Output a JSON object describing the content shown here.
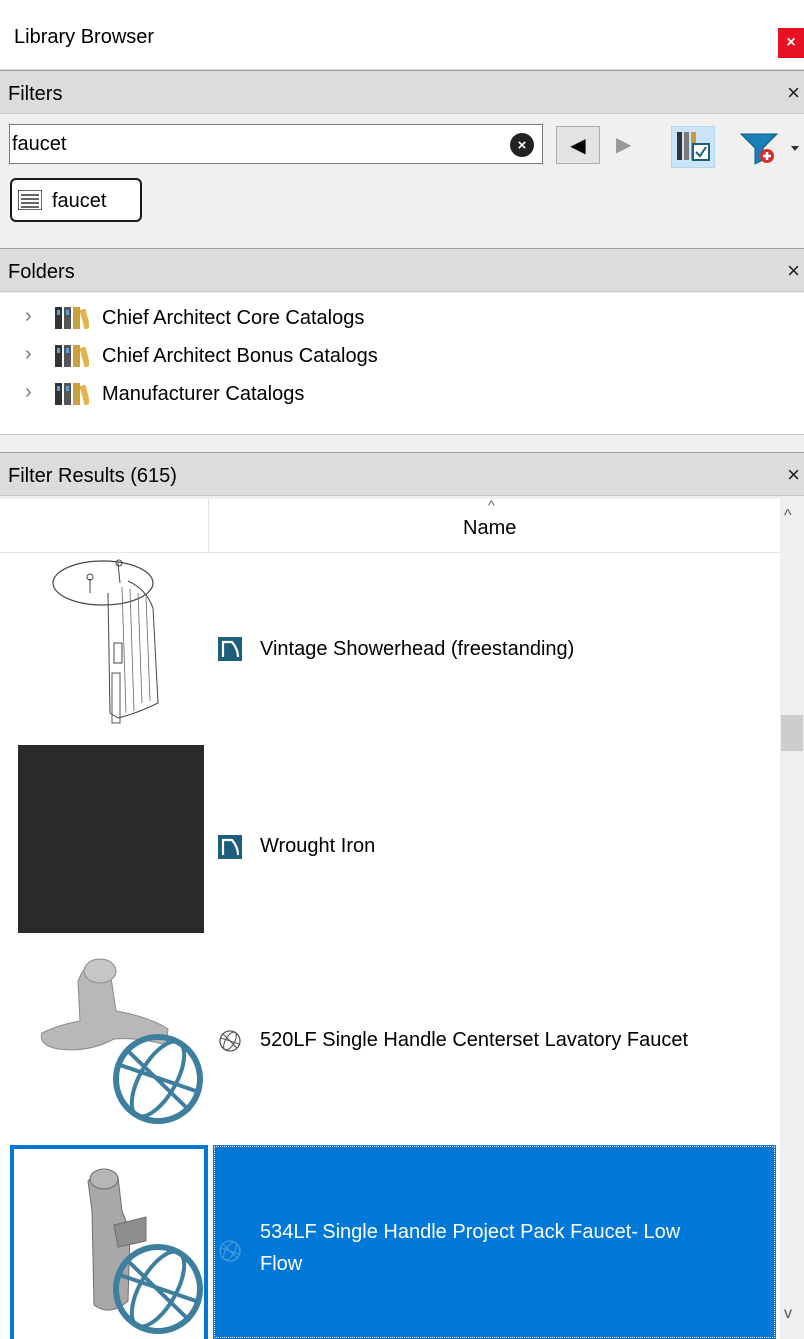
{
  "window": {
    "title": "Library Browser",
    "close_glyph": "×"
  },
  "filters": {
    "header": "Filters",
    "close_glyph": "×",
    "search_value": "faucet",
    "clear_glyph": "×",
    "nav_back_glyph": "◀",
    "nav_forward_glyph": "▶",
    "active_filter": "faucet"
  },
  "folders": {
    "header": "Folders",
    "close_glyph": "×",
    "items": [
      {
        "label": "Chief Architect Core Catalogs",
        "chevron": "›"
      },
      {
        "label": "Chief Architect Bonus Catalogs",
        "chevron": "›"
      },
      {
        "label": "Manufacturer Catalogs",
        "chevron": "›"
      }
    ]
  },
  "results": {
    "header": "Filter Results (615)",
    "close_glyph": "×",
    "column_name": "Name",
    "sort_glyph": "^",
    "scroll_up_glyph": "^",
    "scroll_down_glyph": "v",
    "rows": [
      {
        "name": "Vintage Showerhead (freestanding)",
        "icon": "library-object-icon",
        "selected": false
      },
      {
        "name": "Wrought Iron",
        "icon": "library-object-icon",
        "selected": false
      },
      {
        "name": "520LF Single Handle Centerset Lavatory Faucet",
        "icon": "globe-icon",
        "selected": false
      },
      {
        "name_line1": "534LF Single Handle Project Pack Faucet- Low",
        "name_line2": "Flow",
        "icon": "globe-icon",
        "selected": true
      }
    ]
  },
  "colors": {
    "selection": "#0078d7",
    "close_red": "#e81123",
    "header_gray": "#dcdcdc",
    "icon_teal": "#1b5f7a",
    "globe_blue": "#3e7fa0"
  }
}
